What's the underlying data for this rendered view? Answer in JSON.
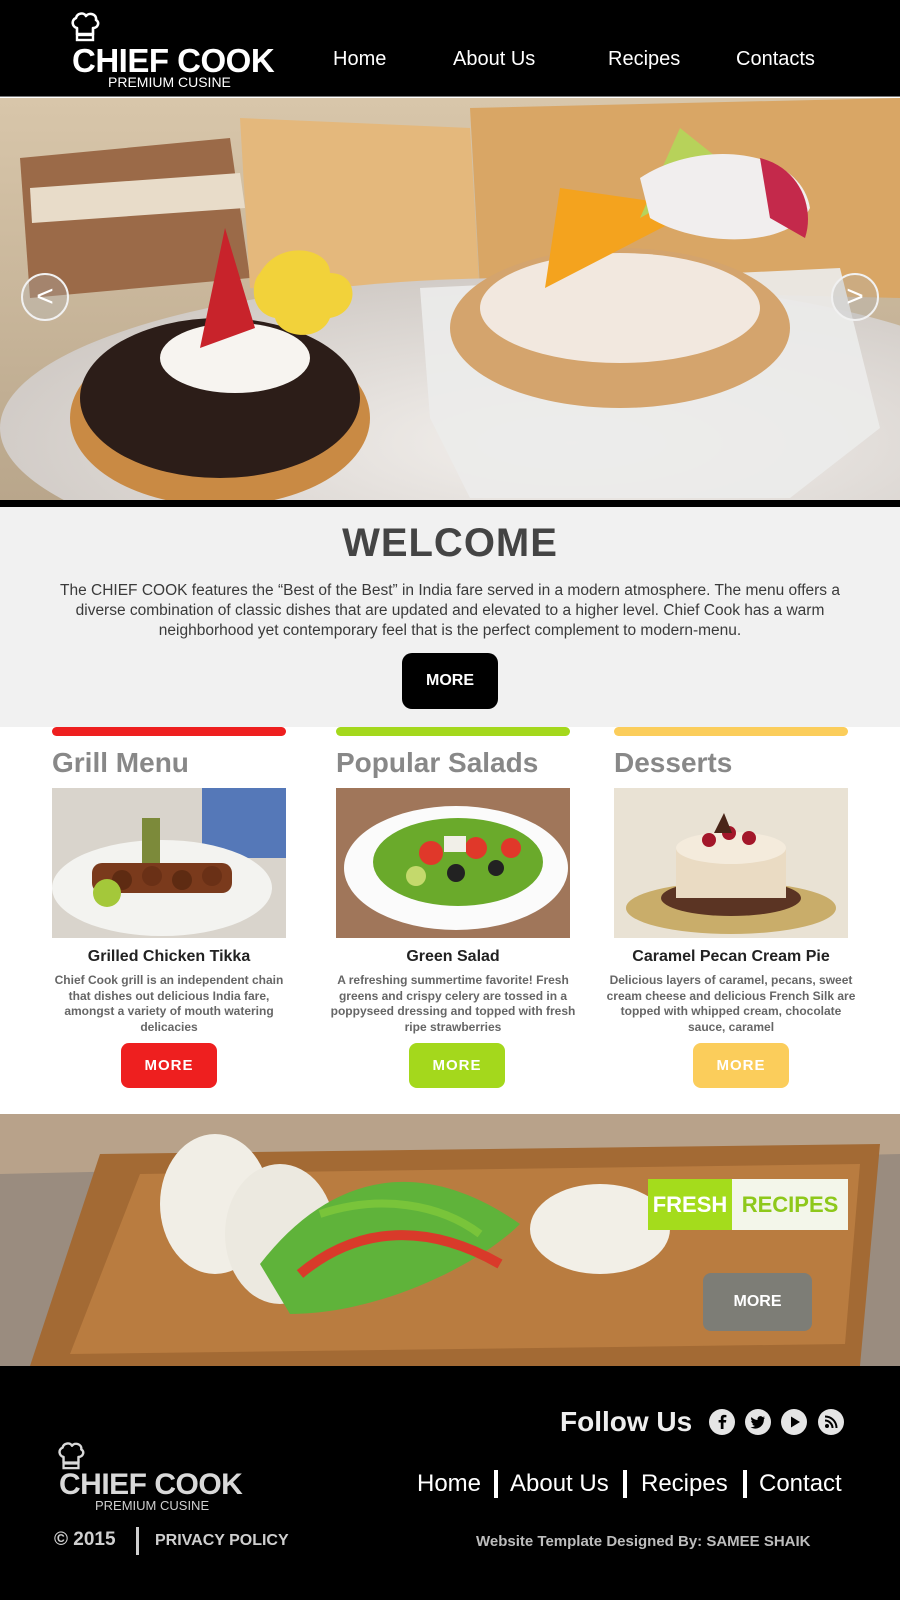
{
  "brand": {
    "name": "CHIEF COOK",
    "tagline": "PREMIUM CUSINE"
  },
  "nav": [
    {
      "label": "Home"
    },
    {
      "label": "About Us"
    },
    {
      "label": "Recipes"
    },
    {
      "label": "Contacts"
    }
  ],
  "hero": {
    "prev_label": "<",
    "next_label": ">"
  },
  "welcome": {
    "title": "WELCOME",
    "text": "The CHIEF COOK features the “Best of the Best” in India fare served in a modern atmosphere. The menu offers a diverse combination of classic dishes that are updated and elevated to a higher level. Chief Cook has a warm neighborhood yet contemporary feel that is the perfect complement to modern-menu.",
    "button": "MORE"
  },
  "columns": [
    {
      "heading": "Grill Menu",
      "item": "Grilled Chicken Tikka",
      "desc": "Chief Cook grill is an independent chain that dishes out delicious India fare, amongst a variety of mouth watering delicacies",
      "button": "MORE",
      "color": "#ee1f1f"
    },
    {
      "heading": "Popular Salads",
      "item": "Green Salad",
      "desc": "A refreshing summertime favorite! Fresh greens and crispy celery are tossed in a poppyseed dressing and topped with fresh ripe strawberries",
      "button": "MORE",
      "color": "#a4d81c"
    },
    {
      "heading": "Desserts",
      "item": "Caramel Pecan Cream Pie",
      "desc": "Delicious layers of caramel, pecans, sweet cream cheese and delicious French Silk are topped with whipped cream, chocolate sauce, caramel",
      "button": "MORE",
      "color": "#fbcd5b"
    }
  ],
  "banner": {
    "word1": "FRESH",
    "word2": "RECIPES",
    "button": "MORE"
  },
  "footer": {
    "follow": "Follow Us",
    "social": [
      "facebook-icon",
      "twitter-icon",
      "youtube-icon",
      "rss-icon"
    ],
    "links": [
      {
        "label": "Home"
      },
      {
        "label": "About Us"
      },
      {
        "label": "Recipes"
      },
      {
        "label": "Contact"
      }
    ],
    "copyright": "© 2015",
    "privacy": "PRIVACY POLICY",
    "credit": "Website Template Designed By: SAMEE SHAIK"
  }
}
